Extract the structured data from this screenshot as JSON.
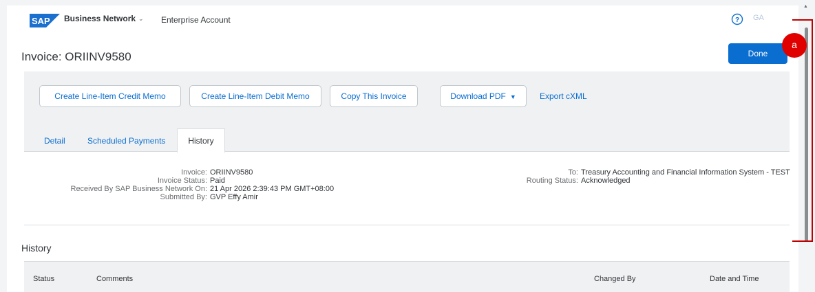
{
  "header": {
    "logo_text": "SAP",
    "brand": "Business Network",
    "account": "Enterprise Account",
    "user_initials": "GA"
  },
  "page": {
    "title": "Invoice: ORIINV9580",
    "done_label": "Done"
  },
  "toolbar": {
    "credit_memo": "Create Line-Item Credit Memo",
    "debit_memo": "Create Line-Item Debit Memo",
    "copy_invoice": "Copy This Invoice",
    "download_pdf": "Download PDF",
    "export_cxml": "Export cXML"
  },
  "tabs": [
    {
      "label": "Detail"
    },
    {
      "label": "Scheduled Payments"
    },
    {
      "label": "History",
      "active": true
    }
  ],
  "details": {
    "left": [
      {
        "label": "Invoice:",
        "value": "ORIINV9580"
      },
      {
        "label": "Invoice Status:",
        "value": "Paid"
      },
      {
        "label": "Received By SAP Business Network On:",
        "value": "21 Apr 2026 2:39:43 PM GMT+08:00"
      },
      {
        "label": "Submitted By:",
        "value": "GVP Effy Amir"
      }
    ],
    "right": [
      {
        "label": "To:",
        "value": "Treasury Accounting and Financial Information System - TEST"
      },
      {
        "label": "Routing Status:",
        "value": "Acknowledged"
      }
    ]
  },
  "history": {
    "title": "History",
    "columns": [
      "Status",
      "Comments",
      "Changed By",
      "Date and Time"
    ]
  },
  "annotation": {
    "label": "a",
    "color": "#e00000"
  },
  "colors": {
    "accent": "#0a6ed1",
    "toolbar_bg": "#eff1f2"
  }
}
